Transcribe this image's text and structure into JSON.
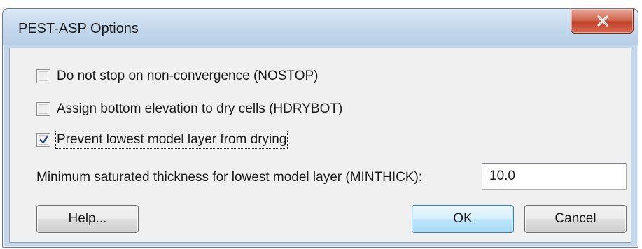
{
  "window": {
    "title": "PEST-ASP Options",
    "close_glyph": "x"
  },
  "options": [
    {
      "label": "Do not stop on non-convergence (NOSTOP)",
      "checked": false
    },
    {
      "label": "Assign bottom elevation to dry cells (HDRYBOT)",
      "checked": false
    },
    {
      "label": "Prevent lowest model layer from drying",
      "checked": true
    }
  ],
  "minthick": {
    "label": "Minimum saturated thickness for lowest model layer (MINTHICK):",
    "value": "10.0"
  },
  "buttons": {
    "help": "Help...",
    "ok": "OK",
    "cancel": "Cancel"
  },
  "icons": {
    "close": "close-icon",
    "check": "checkmark-icon"
  },
  "colors": {
    "titlebar": "#c3d7ec",
    "close_button": "#c7462d",
    "client_bg": "#f0f0f0",
    "default_button": "#bee6fd",
    "checkmark": "#2a4d8f"
  }
}
